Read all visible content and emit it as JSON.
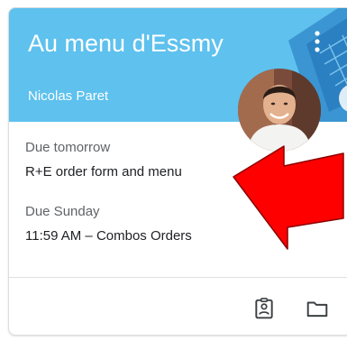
{
  "class_card": {
    "title": "Au menu d'Essmy",
    "teacher": "Nicolas Paret",
    "header_color": "#5ec1ee",
    "due": [
      {
        "label": "Due tomorrow",
        "item": "R+E order form and menu"
      },
      {
        "label": "Due Sunday",
        "item": "11:59 AM – Combos Orders"
      }
    ],
    "icons": {
      "more": "more-vert-icon",
      "work": "assignment-ind-icon",
      "folder": "folder-icon"
    }
  },
  "overlay": {
    "arrow_color": "#ff0000",
    "arrow_outline": "#8b0000"
  }
}
